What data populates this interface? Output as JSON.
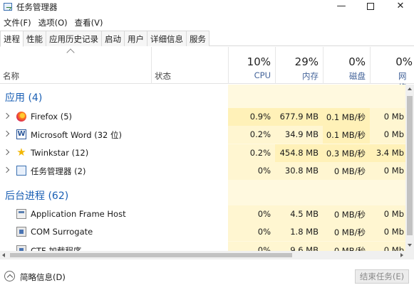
{
  "window": {
    "title": "任务管理器"
  },
  "menu": [
    "文件(F)",
    "选项(O)",
    "查看(V)"
  ],
  "tabs": [
    "进程",
    "性能",
    "应用历史记录",
    "启动",
    "用户",
    "详细信息",
    "服务"
  ],
  "header": {
    "name_label": "名称",
    "status_label": "状态",
    "cpu": {
      "pct": "10%",
      "label": "CPU"
    },
    "memory": {
      "pct": "29%",
      "label": "内存"
    },
    "disk": {
      "pct": "0%",
      "label": "磁盘"
    },
    "network": {
      "pct": "0%",
      "label": "网络"
    }
  },
  "groups": [
    {
      "title": "应用 (4)"
    },
    {
      "title": "后台进程 (62)"
    }
  ],
  "apps": [
    {
      "name": "Firefox (5)",
      "icon": "firefox-icon",
      "cpu": "0.9%",
      "mem": "677.9 MB",
      "disk": "0.1 MB/秒",
      "net": "0 Mb"
    },
    {
      "name": "Microsoft Word (32 位)",
      "icon": "word-icon",
      "cpu": "0.2%",
      "mem": "34.9 MB",
      "disk": "0.1 MB/秒",
      "net": "0 Mb"
    },
    {
      "name": "Twinkstar (12)",
      "icon": "star-icon",
      "cpu": "0.2%",
      "mem": "454.8 MB",
      "disk": "0.3 MB/秒",
      "net": "3.4 Mb"
    },
    {
      "name": "任务管理器 (2)",
      "icon": "task-manager-icon",
      "cpu": "0%",
      "mem": "30.8 MB",
      "disk": "0 MB/秒",
      "net": "0 Mb"
    }
  ],
  "background": [
    {
      "name": "Application Frame Host",
      "icon": "app-frame-icon",
      "cpu": "0%",
      "mem": "4.5 MB",
      "disk": "0 MB/秒",
      "net": "0 Mb"
    },
    {
      "name": "COM Surrogate",
      "icon": "com-surrogate-icon",
      "cpu": "0%",
      "mem": "1.8 MB",
      "disk": "0 MB/秒",
      "net": "0 Mb"
    },
    {
      "name": "CTF 加载程序",
      "icon": "ctf-icon",
      "cpu": "0%",
      "mem": "9.6 MB",
      "disk": "0 MB/秒",
      "net": "0 Mb"
    }
  ],
  "footer": {
    "fewer_details": "简略信息(D)",
    "end_task": "结束任务(E)"
  }
}
